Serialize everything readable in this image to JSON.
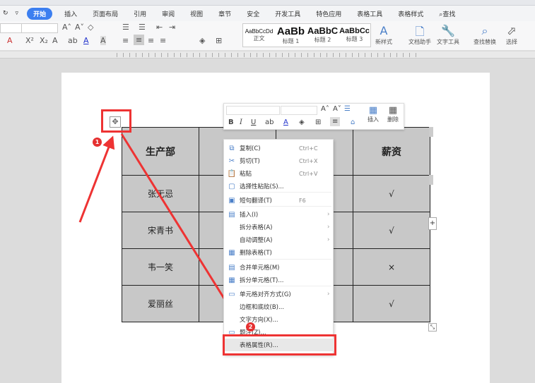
{
  "menu": {
    "tabs": [
      "开始",
      "插入",
      "页面布局",
      "引用",
      "审阅",
      "视图",
      "章节",
      "安全",
      "开发工具",
      "特色应用",
      "表格工具",
      "表格样式",
      "查找"
    ]
  },
  "toolbar": {
    "styles": [
      {
        "sample": "AaBbCcDd",
        "name": "正文"
      },
      {
        "sample": "AaBb",
        "name": "标题 1"
      },
      {
        "sample": "AaBbC",
        "name": "标题 2"
      },
      {
        "sample": "AaBbCc",
        "name": "标题 3"
      }
    ],
    "buttons": [
      "新样式",
      "文档助手",
      "文字工具",
      "查找替换",
      "选择"
    ]
  },
  "table": {
    "headers": [
      "生产部",
      "",
      "",
      "薪资"
    ],
    "rows": [
      [
        "张无忌",
        "",
        "",
        "√"
      ],
      [
        "宋青书",
        "",
        "",
        "√"
      ],
      [
        "韦一笑",
        "",
        "",
        "×"
      ],
      [
        "爱丽丝",
        "",
        "",
        "√"
      ]
    ]
  },
  "mini_toolbar": {
    "insert": "插入",
    "delete": "删除"
  },
  "context_menu": [
    {
      "label": "复制(C)",
      "shortcut": "Ctrl+C",
      "icon": "⧉"
    },
    {
      "label": "剪切(T)",
      "shortcut": "Ctrl+X",
      "icon": "✂"
    },
    {
      "label": "粘贴",
      "shortcut": "Ctrl+V",
      "icon": "📋"
    },
    {
      "label": "选择性粘贴(S)...",
      "shortcut": "",
      "icon": "▢"
    },
    {
      "label": "短句翻译(T)",
      "shortcut": "F6",
      "icon": "▣"
    },
    {
      "label": "插入(I)",
      "shortcut": "",
      "icon": "▤",
      "sub": true
    },
    {
      "label": "拆分表格(A)",
      "shortcut": "",
      "icon": "",
      "sub": true
    },
    {
      "label": "自动调整(A)",
      "shortcut": "",
      "icon": "",
      "sub": true
    },
    {
      "label": "删除表格(T)",
      "shortcut": "",
      "icon": "▦"
    },
    {
      "label": "合并单元格(M)",
      "shortcut": "",
      "icon": "▤"
    },
    {
      "label": "拆分单元格(T)...",
      "shortcut": "",
      "icon": "▦"
    },
    {
      "label": "单元格对齐方式(G)",
      "shortcut": "",
      "icon": "▭",
      "sub": true
    },
    {
      "label": "边框和底纹(B)...",
      "shortcut": "",
      "icon": ""
    },
    {
      "label": "文字方向(X)...",
      "shortcut": "",
      "icon": ""
    },
    {
      "label": "题注(Z)...",
      "shortcut": "",
      "icon": "▭"
    },
    {
      "label": "表格属性(R)...",
      "shortcut": "",
      "icon": ""
    }
  ],
  "badges": [
    "1",
    "2"
  ],
  "colors": {
    "accent": "#3c7ff0",
    "annotation": "#ee3333"
  }
}
